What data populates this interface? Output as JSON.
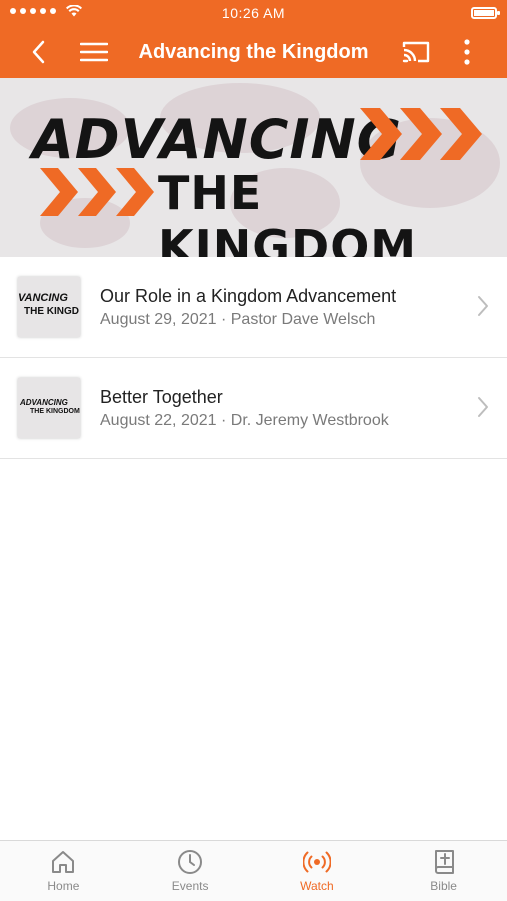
{
  "status_bar": {
    "time": "10:26 AM",
    "battery_level": 1.0
  },
  "nav": {
    "title": "Advancing the Kingdom",
    "back_icon": "chevron-left-icon",
    "menu_icon": "hamburger-menu-icon",
    "cast_icon": "cast-icon",
    "more_icon": "more-vertical-icon"
  },
  "banner": {
    "line1": "ADVANCING",
    "line2": "THE KINGDOM"
  },
  "sermons": [
    {
      "title": "Our Role in a Kingdom Advancement",
      "subtitle": "August 29, 2021 · Pastor Dave Welsch",
      "thumb_line1": "VANCING",
      "thumb_line2": "THE KINGD"
    },
    {
      "title": "Better Together",
      "subtitle": "August 22, 2021 · Dr. Jeremy Westbrook",
      "thumb_line1": "ADVANCING",
      "thumb_line2": "THE KINGDOM"
    }
  ],
  "tabs": [
    {
      "label": "Home",
      "icon": "home-icon"
    },
    {
      "label": "Events",
      "icon": "clock-icon"
    },
    {
      "label": "Watch",
      "icon": "broadcast-icon"
    },
    {
      "label": "Bible",
      "icon": "bible-icon"
    }
  ],
  "colors": {
    "accent": "#ef6a25"
  }
}
